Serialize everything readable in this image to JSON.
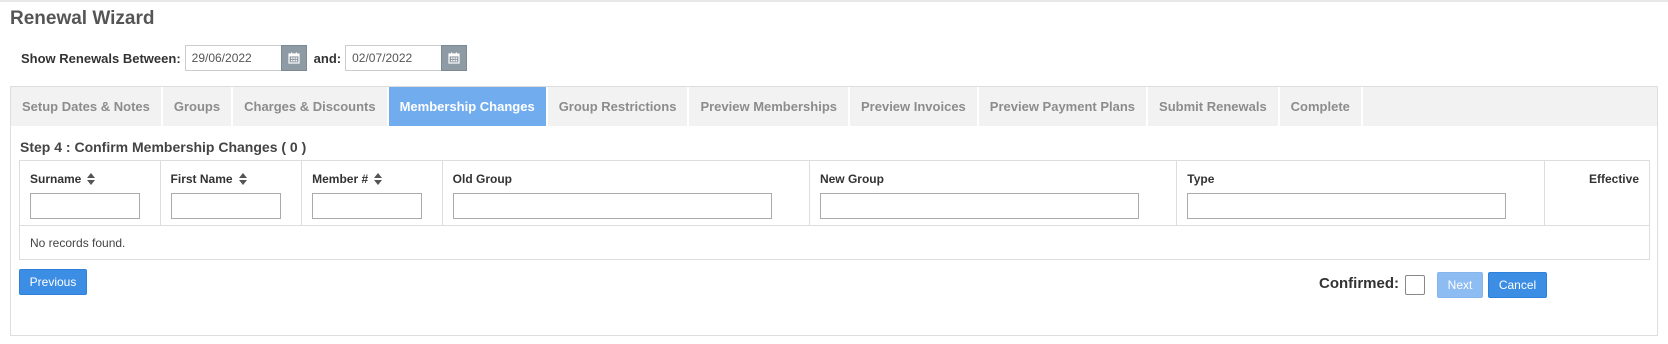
{
  "page": {
    "title": "Renewal Wizard"
  },
  "filters": {
    "show_label": "Show Renewals Between:",
    "start_date": "29/06/2022",
    "and_label": "and:",
    "end_date": "02/07/2022"
  },
  "tabs": [
    {
      "label": "Setup Dates & Notes",
      "active": false
    },
    {
      "label": "Groups",
      "active": false
    },
    {
      "label": "Charges & Discounts",
      "active": false
    },
    {
      "label": "Membership Changes",
      "active": true
    },
    {
      "label": "Group Restrictions",
      "active": false
    },
    {
      "label": "Preview Memberships",
      "active": false
    },
    {
      "label": "Preview Invoices",
      "active": false
    },
    {
      "label": "Preview Payment Plans",
      "active": false
    },
    {
      "label": "Submit Renewals",
      "active": false
    },
    {
      "label": "Complete",
      "active": false
    }
  ],
  "step": {
    "title": "Step 4 : Confirm Membership Changes ( 0 )"
  },
  "table": {
    "columns": [
      {
        "label": "Surname",
        "sortable": true
      },
      {
        "label": "First Name",
        "sortable": true
      },
      {
        "label": "Member #",
        "sortable": true
      },
      {
        "label": "Old Group",
        "sortable": false
      },
      {
        "label": "New Group",
        "sortable": false
      },
      {
        "label": "Type",
        "sortable": false
      },
      {
        "label": "Effective",
        "sortable": false
      }
    ],
    "empty_message": "No records found."
  },
  "footer": {
    "previous_label": "Previous",
    "confirmed_label": "Confirmed:",
    "next_label": "Next",
    "cancel_label": "Cancel"
  },
  "colors": {
    "active_tab": "#70acee",
    "primary_button": "#3c8de4",
    "disabled_button": "#8cbcf2",
    "calendar_button": "#8e9aa4"
  },
  "icons": {
    "calendar": "calendar-icon",
    "sort": "sort-icon"
  }
}
